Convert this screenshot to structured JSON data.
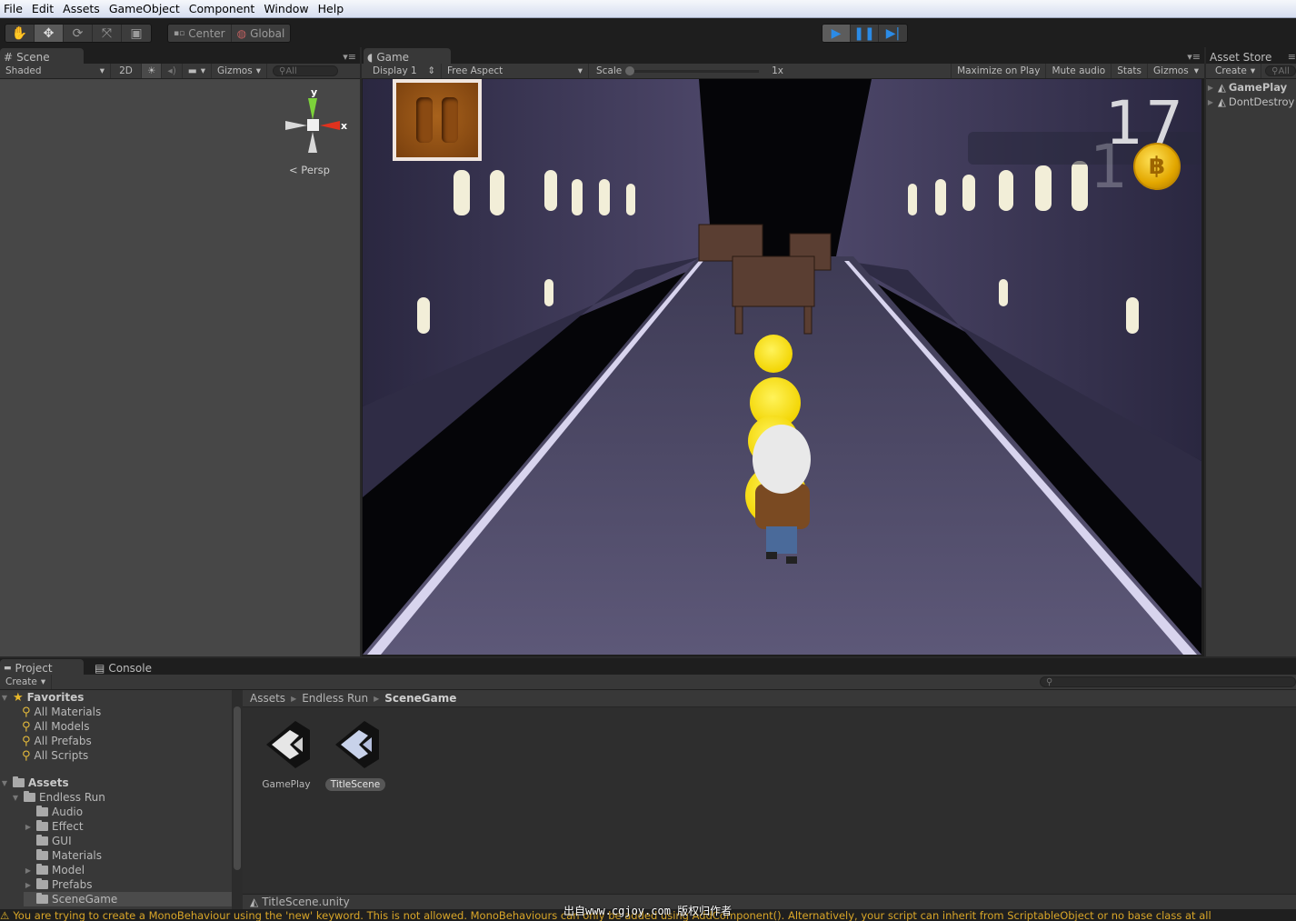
{
  "menu": [
    "File",
    "Edit",
    "Assets",
    "GameObject",
    "Component",
    "Window",
    "Help"
  ],
  "toolbar": {
    "tools": [
      "hand-tool",
      "move-tool",
      "rotate-tool",
      "scale-tool",
      "rect-tool"
    ],
    "active_tool": "move-tool",
    "pivot_label": "Center",
    "space_label": "Global",
    "play_active": true
  },
  "scene": {
    "tab_label": "Scene",
    "shading_mode": "Shaded",
    "mode_2d_label": "2D",
    "gizmos_label": "Gizmos",
    "search_placeholder": "All",
    "gizmo_axis_y": "y",
    "gizmo_axis_x": "x",
    "projection_label": "Persp"
  },
  "game": {
    "tab_label": "Game",
    "display": "Display 1",
    "aspect": "Free Aspect",
    "scale_label": "Scale",
    "scale_value": "1x",
    "maximize_label": "Maximize on Play",
    "mute_label": "Mute audio",
    "stats_label": "Stats",
    "gizmos_label": "Gizmos",
    "hud": {
      "score": "17",
      "coin_count": "1",
      "coin_symbol": "฿"
    }
  },
  "hierarchy": {
    "tab_label": "Asset Store",
    "create_label": "Create",
    "search_placeholder": "All",
    "items": [
      {
        "label": "GamePlay",
        "bold": true
      },
      {
        "label": "DontDestroy",
        "bold": false
      }
    ]
  },
  "project": {
    "tabs": [
      "Project",
      "Console"
    ],
    "create_label": "Create",
    "search_placeholder": "",
    "favorites_label": "Favorites",
    "favorites": [
      "All Materials",
      "All Models",
      "All Prefabs",
      "All Scripts"
    ],
    "assets_label": "Assets",
    "tree": [
      {
        "label": "Endless Run",
        "expanded": true
      },
      {
        "label": "Audio",
        "has_children": false
      },
      {
        "label": "Effect",
        "has_children": true
      },
      {
        "label": "GUI",
        "has_children": false
      },
      {
        "label": "Materials",
        "has_children": false
      },
      {
        "label": "Model",
        "has_children": true
      },
      {
        "label": "Prefabs",
        "has_children": true
      },
      {
        "label": "SceneGame",
        "has_children": false,
        "selected": true
      }
    ],
    "breadcrumb": [
      "Assets",
      "Endless Run",
      "SceneGame"
    ],
    "assets": [
      {
        "label": "GamePlay",
        "selected": false
      },
      {
        "label": "TitleScene",
        "selected": true
      }
    ],
    "footer_file": "TitleScene.unity"
  },
  "status": {
    "message": "You are trying to create a MonoBehaviour using the 'new' keyword.  This is not allowed.  MonoBehaviours can only be added using AddComponent().  Alternatively, your script can inherit from ScriptableObject or no base class at all",
    "watermark": "出自www.cgjoy.com 版权归作者"
  },
  "colors": {
    "play_accent": "#2b8be6",
    "warning": "#d9a628",
    "coin": "#f2c400"
  }
}
